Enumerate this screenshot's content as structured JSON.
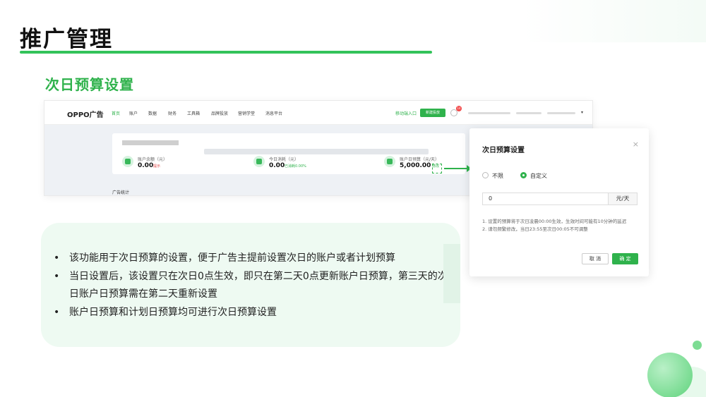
{
  "slide": {
    "title": "推广管理",
    "section_title": "次日预算设置"
  },
  "app": {
    "logo": "OPPO广告",
    "nav": [
      "首页",
      "账户",
      "数据",
      "财务",
      "工具箱",
      "品牌投放",
      "营销学堂",
      "消息平台"
    ],
    "nav_right_link": "移动端入口",
    "new_button": "新建投放",
    "message_badge": "14",
    "metrics": [
      {
        "label": "账户余额（元）",
        "value": "0.00",
        "extra": "提示"
      },
      {
        "label": "今日消耗（元）",
        "value": "0.00",
        "extra": "已消耗0.00%"
      },
      {
        "label": "账户日预算（元/天）",
        "value": "5,000.00",
        "extra": "修改"
      }
    ],
    "footer_label": "广告统计"
  },
  "dialog": {
    "title": "次日预算设置",
    "close_glyph": "×",
    "radio_unlimited": "不限",
    "radio_custom": "自定义",
    "input_value": "0",
    "unit": "元/天",
    "note_1": "1. 设置的预算将于次日凌晨00:00生效，生效时间可能有10分钟的延迟",
    "note_2": "2. 请勿频繁修改，当日23:55至次日00:05不可调整",
    "cancel_label": "取 消",
    "ok_label": "确 定"
  },
  "bullets": [
    "该功能用于次日预算的设置，便于广告主提前设置次日的账户或者计划预算",
    "当日设置后，该设置只在次日0点生效，即只在第二天0点更新账户日预算，第三天的次日账户日预算需在第二天重新设置",
    "账户日预算和计划日预算均可进行次日预算设置"
  ],
  "colors": {
    "accent": "#2fb24c",
    "panel_bg": "#eefaf2"
  }
}
